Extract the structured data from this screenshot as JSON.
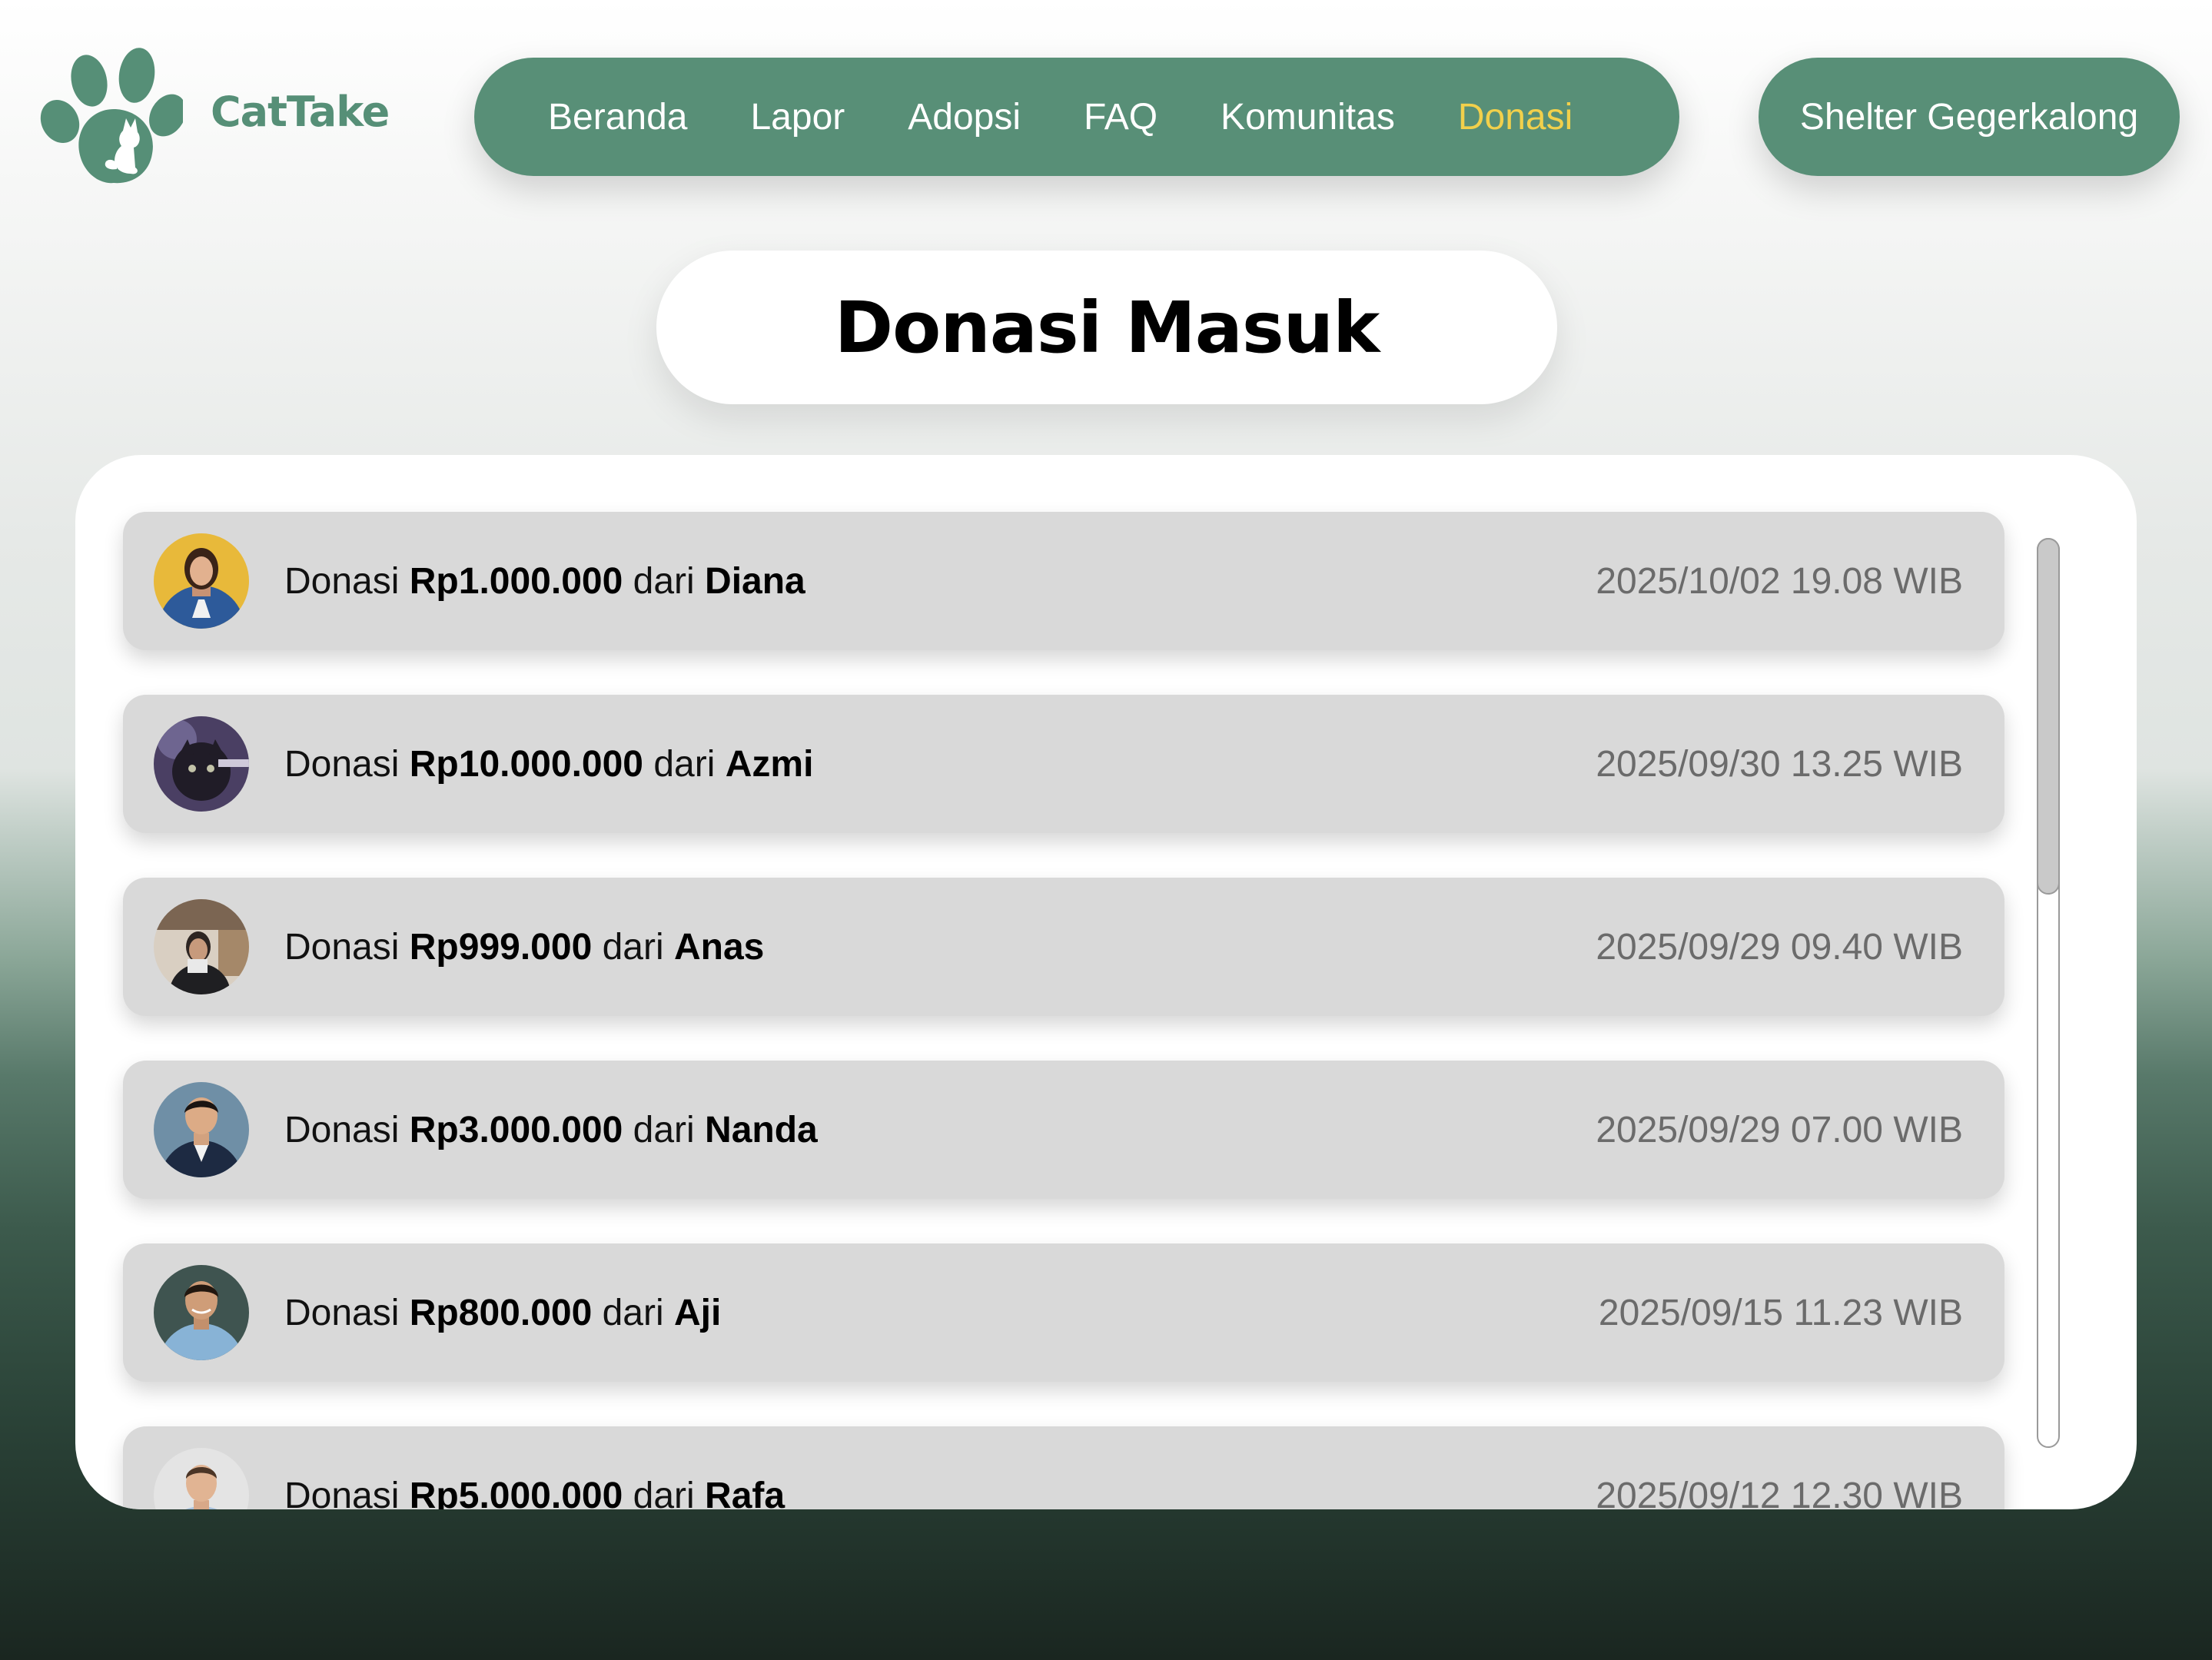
{
  "brand": {
    "name": "CatTake",
    "color": "#588f77"
  },
  "nav": {
    "items": [
      {
        "label": "Beranda",
        "active": false
      },
      {
        "label": "Lapor",
        "active": false
      },
      {
        "label": "Adopsi",
        "active": false
      },
      {
        "label": "FAQ",
        "active": false
      },
      {
        "label": "Komunitas",
        "active": false
      },
      {
        "label": "Donasi",
        "active": true
      }
    ],
    "active_color": "#f2d04b"
  },
  "shelter": {
    "label": "Shelter Gegerkalong"
  },
  "page": {
    "title": "Donasi Masuk"
  },
  "donations": [
    {
      "prefix": "Donasi",
      "amount": "Rp1.000.000",
      "from_word": "dari",
      "name": "Diana",
      "date": "2025/10/02 19.08 WIB",
      "avatar": "avatar-diana"
    },
    {
      "prefix": "Donasi",
      "amount": "Rp10.000.000",
      "from_word": "dari",
      "name": "Azmi",
      "date": "2025/09/30 13.25 WIB",
      "avatar": "avatar-azmi"
    },
    {
      "prefix": "Donasi",
      "amount": "Rp999.000",
      "from_word": "dari",
      "name": "Anas",
      "date": "2025/09/29 09.40 WIB",
      "avatar": "avatar-anas"
    },
    {
      "prefix": "Donasi",
      "amount": "Rp3.000.000",
      "from_word": "dari",
      "name": "Nanda",
      "date": "2025/09/29 07.00 WIB",
      "avatar": "avatar-nanda"
    },
    {
      "prefix": "Donasi",
      "amount": "Rp800.000",
      "from_word": "dari",
      "name": "Aji",
      "date": "2025/09/15 11.23 WIB",
      "avatar": "avatar-aji"
    },
    {
      "prefix": "Donasi",
      "amount": "Rp5.000.000",
      "from_word": "dari",
      "name": "Rafa",
      "date": "2025/09/12 12.30 WIB",
      "avatar": "avatar-rafa"
    }
  ],
  "scroll": {
    "position": 0,
    "visible_fraction": 0.39
  }
}
